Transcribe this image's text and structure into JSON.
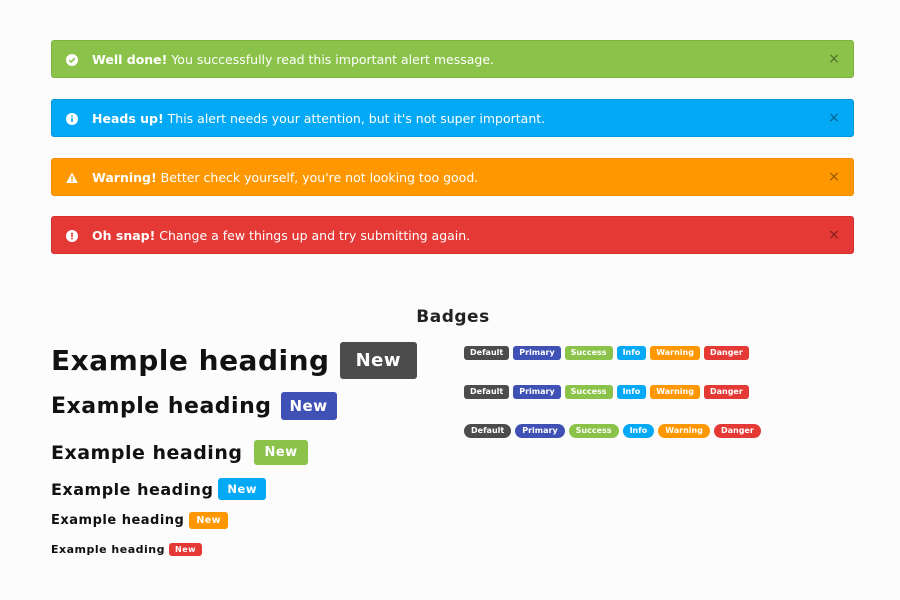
{
  "alerts": [
    {
      "type": "success",
      "icon": "check-circle-icon",
      "strong": "Well done!",
      "text": " You successfully read this important alert message.",
      "close": "×"
    },
    {
      "type": "info",
      "icon": "info-circle-icon",
      "strong": "Heads up!",
      "text": " This alert needs your attention, but it's not super important.",
      "close": "×"
    },
    {
      "type": "warning",
      "icon": "warning-triangle-icon",
      "strong": "Warning!",
      "text": " Better check yourself, you're not looking too good.",
      "close": "×"
    },
    {
      "type": "danger",
      "icon": "exclamation-circle-icon",
      "strong": "Oh snap!",
      "text": " Change a few things up and try submitting again.",
      "close": "×"
    }
  ],
  "badges_section": {
    "title": "Badges"
  },
  "headings": [
    {
      "text": "Example heading",
      "label": "New"
    },
    {
      "text": "Example heading",
      "label": "New"
    },
    {
      "text": "Example heading",
      "label": "New"
    },
    {
      "text": "Example heading",
      "label": "New"
    },
    {
      "text": "Example heading",
      "label": "New"
    },
    {
      "text": "Example heading",
      "label": "New"
    }
  ],
  "badges": [
    "Default",
    "Primary",
    "Success",
    "Info",
    "Warning",
    "Danger"
  ],
  "colors": {
    "default": "#4c4c4c",
    "primary": "#3f51b5",
    "success": "#8bc34a",
    "info": "#03a9f4",
    "warning": "#ff9800",
    "danger": "#e53935"
  }
}
